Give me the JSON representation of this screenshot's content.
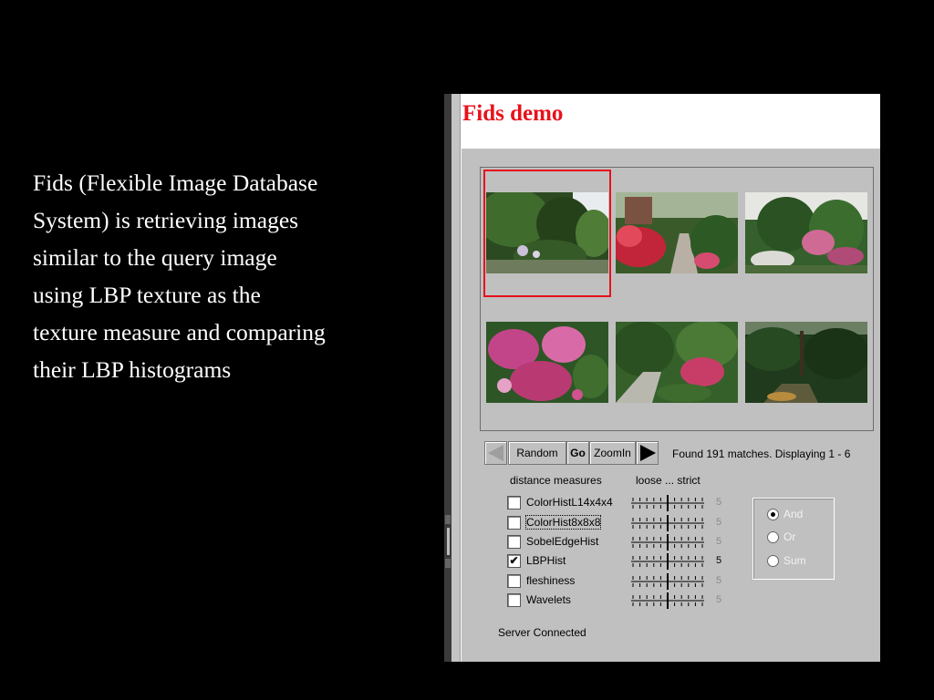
{
  "caption": {
    "lines": [
      "Fids (Flexible Image Database",
      "System) is retrieving images",
      "similar to the query image",
      "using LBP texture as the",
      "texture measure and comparing",
      "their LBP histograms"
    ]
  },
  "app": {
    "title": "Fids demo",
    "title_color": "#e8111b",
    "images": [
      "garden-trees-path",
      "red-rhododendrons-walkway",
      "flowering-garden-trees",
      "pink-flower-bushes",
      "garden-path-flowers",
      "dark-forest-path"
    ],
    "selected_image_index": 0,
    "toolbar": {
      "prev_icon": "left-arrow-icon",
      "random_label": "Random",
      "go_label": "Go",
      "zoom_label": "ZoomIn",
      "next_icon": "right-arrow-icon"
    },
    "status": "Found 191 matches.  Displaying 1 - 6",
    "distance_label": "distance measures",
    "scale_label": "loose ... strict",
    "measures": [
      {
        "name": "ColorHistL14x4x4",
        "checked": false,
        "value": "5"
      },
      {
        "name": "ColorHist8x8x8",
        "checked": false,
        "value": "5"
      },
      {
        "name": "SobelEdgeHist",
        "checked": false,
        "value": "5"
      },
      {
        "name": "LBPHist",
        "checked": true,
        "value": "5"
      },
      {
        "name": "fleshiness",
        "checked": false,
        "value": "5"
      },
      {
        "name": "Wavelets",
        "checked": false,
        "value": "5"
      }
    ],
    "combine": {
      "options": [
        "And",
        "Or",
        "Sum"
      ],
      "selected": "And"
    },
    "server_status": "Server Connected"
  }
}
